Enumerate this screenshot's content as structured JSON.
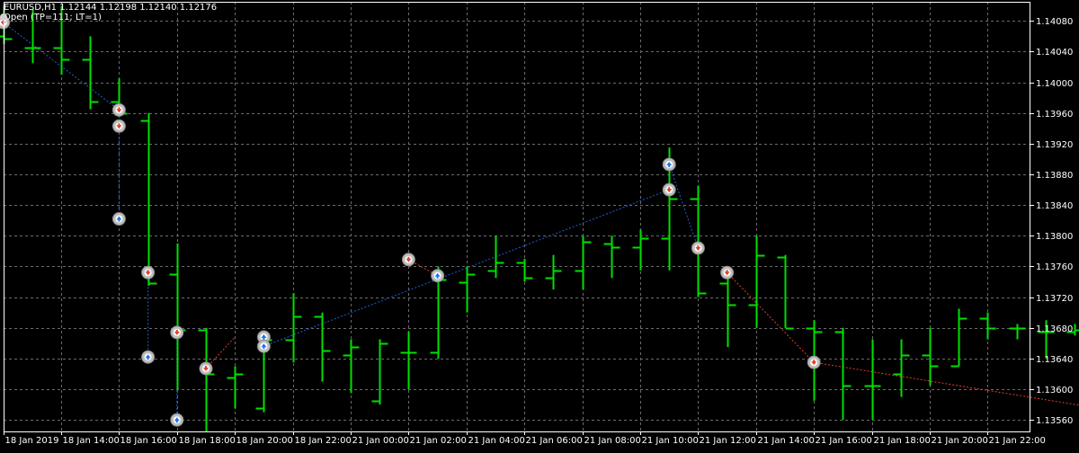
{
  "header": {
    "symbol_line": "EURUSD,H1  1.12144 1.12198 1.12140 1.12176",
    "indicator_line": "Open (TP=111; LT=1)"
  },
  "colors": {
    "background": "#000000",
    "grid": "#6b6b6b",
    "axis": "#ffffff",
    "bar": "#00e000",
    "buy_path": "#1f5fd0",
    "sell_path": "#e0402a",
    "marker_ring": "#bdbdbd",
    "buy_marker": "#1e73e8",
    "sell_marker": "#e0402a"
  },
  "chart_data": {
    "type": "ohlc",
    "symbol": "EURUSD",
    "timeframe": "H1",
    "ylim": [
      1.13545,
      1.14105
    ],
    "y_ticks": [
      "1.14080",
      "1.14040",
      "1.14000",
      "1.13960",
      "1.13920",
      "1.13880",
      "1.13840",
      "1.13800",
      "1.13760",
      "1.13720",
      "1.13680",
      "1.13640",
      "1.13600",
      "1.13560"
    ],
    "x_ticks": [
      "18 Jan 2019",
      "18 Jan 14:00",
      "18 Jan 16:00",
      "18 Jan 18:00",
      "18 Jan 20:00",
      "18 Jan 22:00",
      "21 Jan 00:00",
      "21 Jan 02:00",
      "21 Jan 04:00",
      "21 Jan 06:00",
      "21 Jan 08:00",
      "21 Jan 10:00",
      "21 Jan 12:00",
      "21 Jan 14:00",
      "21 Jan 16:00",
      "21 Jan 18:00",
      "21 Jan 20:00",
      "21 Jan 22:00"
    ],
    "bars": [
      {
        "time": "18 Jan 12:00",
        "open": 1.1406,
        "high": 1.141,
        "low": 1.1405,
        "close": 1.14057
      },
      {
        "time": "18 Jan 13:00",
        "open": 1.14045,
        "high": 1.14095,
        "low": 1.14025,
        "close": 1.14045
      },
      {
        "time": "18 Jan 14:00",
        "open": 1.14045,
        "high": 1.141,
        "low": 1.1401,
        "close": 1.1403
      },
      {
        "time": "18 Jan 15:00",
        "open": 1.1403,
        "high": 1.1406,
        "low": 1.13965,
        "close": 1.13975
      },
      {
        "time": "18 Jan 16:00",
        "open": 1.13975,
        "high": 1.14005,
        "low": 1.13955,
        "close": 1.1396
      },
      {
        "time": "18 Jan 17:00",
        "open": 1.1395,
        "high": 1.1396,
        "low": 1.13735,
        "close": 1.13738
      },
      {
        "time": "18 Jan 18:00",
        "open": 1.1375,
        "high": 1.1379,
        "low": 1.136,
        "close": 1.13677
      },
      {
        "time": "18 Jan 19:00",
        "open": 1.13677,
        "high": 1.1368,
        "low": 1.13545,
        "close": 1.1362
      },
      {
        "time": "18 Jan 20:00",
        "open": 1.13615,
        "high": 1.1363,
        "low": 1.13575,
        "close": 1.1362
      },
      {
        "time": "18 Jan 21:00",
        "open": 1.13575,
        "high": 1.1367,
        "low": 1.1357,
        "close": 1.13665
      },
      {
        "time": "18 Jan 22:00",
        "open": 1.13665,
        "high": 1.13725,
        "low": 1.13635,
        "close": 1.13695
      },
      {
        "time": "18 Jan 23:00",
        "open": 1.13695,
        "high": 1.137,
        "low": 1.1361,
        "close": 1.1365
      },
      {
        "time": "21 Jan 00:00",
        "open": 1.13645,
        "high": 1.13665,
        "low": 1.13595,
        "close": 1.13655
      },
      {
        "time": "21 Jan 01:00",
        "open": 1.13585,
        "high": 1.13665,
        "low": 1.1358,
        "close": 1.1366
      },
      {
        "time": "21 Jan 02:00",
        "open": 1.13648,
        "high": 1.13675,
        "low": 1.136,
        "close": 1.13648
      },
      {
        "time": "21 Jan 03:00",
        "open": 1.13648,
        "high": 1.1376,
        "low": 1.1364,
        "close": 1.13743
      },
      {
        "time": "21 Jan 04:00",
        "open": 1.1374,
        "high": 1.1376,
        "low": 1.137,
        "close": 1.1375
      },
      {
        "time": "21 Jan 05:00",
        "open": 1.13755,
        "high": 1.138,
        "low": 1.13745,
        "close": 1.13765
      },
      {
        "time": "21 Jan 06:00",
        "open": 1.13765,
        "high": 1.1377,
        "low": 1.1374,
        "close": 1.13745
      },
      {
        "time": "21 Jan 07:00",
        "open": 1.13745,
        "high": 1.13775,
        "low": 1.1373,
        "close": 1.13755
      },
      {
        "time": "21 Jan 08:00",
        "open": 1.13755,
        "high": 1.138,
        "low": 1.1373,
        "close": 1.13792
      },
      {
        "time": "21 Jan 09:00",
        "open": 1.1379,
        "high": 1.138,
        "low": 1.13745,
        "close": 1.13785
      },
      {
        "time": "21 Jan 10:00",
        "open": 1.13785,
        "high": 1.13808,
        "low": 1.13755,
        "close": 1.13797
      },
      {
        "time": "21 Jan 11:00",
        "open": 1.13797,
        "high": 1.13915,
        "low": 1.13755,
        "close": 1.13848
      },
      {
        "time": "21 Jan 12:00",
        "open": 1.13848,
        "high": 1.13865,
        "low": 1.1372,
        "close": 1.13725
      },
      {
        "time": "21 Jan 13:00",
        "open": 1.13738,
        "high": 1.1376,
        "low": 1.13655,
        "close": 1.1371
      },
      {
        "time": "21 Jan 14:00",
        "open": 1.1371,
        "high": 1.138,
        "low": 1.1368,
        "close": 1.13775
      },
      {
        "time": "21 Jan 15:00",
        "open": 1.13772,
        "high": 1.13775,
        "low": 1.1368,
        "close": 1.1368
      },
      {
        "time": "21 Jan 16:00",
        "open": 1.1368,
        "high": 1.1369,
        "low": 1.13585,
        "close": 1.13675
      },
      {
        "time": "21 Jan 17:00",
        "open": 1.13675,
        "high": 1.1368,
        "low": 1.1356,
        "close": 1.13605
      },
      {
        "time": "21 Jan 18:00",
        "open": 1.13605,
        "high": 1.13665,
        "low": 1.1356,
        "close": 1.13605
      },
      {
        "time": "21 Jan 19:00",
        "open": 1.1362,
        "high": 1.13665,
        "low": 1.1359,
        "close": 1.13645
      },
      {
        "time": "21 Jan 20:00",
        "open": 1.13645,
        "high": 1.1368,
        "low": 1.13605,
        "close": 1.1363
      },
      {
        "time": "21 Jan 21:00",
        "open": 1.1363,
        "high": 1.13705,
        "low": 1.1363,
        "close": 1.13693
      },
      {
        "time": "21 Jan 22:00",
        "open": 1.13693,
        "high": 1.137,
        "low": 1.13665,
        "close": 1.1368
      },
      {
        "time": "21 Jan 23:00",
        "open": 1.1368,
        "high": 1.13685,
        "low": 1.13665,
        "close": 1.1368
      },
      {
        "time": "22 Jan 00:00",
        "open": 1.13675,
        "high": 1.1369,
        "low": 1.1364,
        "close": 1.13675
      },
      {
        "time": "22 Jan 01:00",
        "open": 1.13675,
        "high": 1.13685,
        "low": 1.1367,
        "close": 1.13677
      },
      {
        "time": "22 Jan 02:00",
        "open": 1.13677,
        "high": 1.1369,
        "low": 1.13675,
        "close": 1.13685
      },
      {
        "time": "22 Jan 03:00",
        "open": 1.13685,
        "high": 1.1371,
        "low": 1.1366,
        "close": 1.1368
      },
      {
        "time": "22 Jan 04:00",
        "open": 1.1368,
        "high": 1.1369,
        "low": 1.13655,
        "close": 1.1366
      }
    ],
    "markers": [
      {
        "time": "18 Jan 12:00",
        "price": 1.14078,
        "side": "sell"
      },
      {
        "time": "18 Jan 16:00",
        "price": 1.13964,
        "side": "sell"
      },
      {
        "time": "18 Jan 16:00",
        "price": 1.13943,
        "side": "sell"
      },
      {
        "time": "18 Jan 16:00",
        "price": 1.13822,
        "side": "buy"
      },
      {
        "time": "18 Jan 17:00",
        "price": 1.13752,
        "side": "sell"
      },
      {
        "time": "18 Jan 17:00",
        "price": 1.13642,
        "side": "buy"
      },
      {
        "time": "18 Jan 18:00",
        "price": 1.13674,
        "side": "sell"
      },
      {
        "time": "18 Jan 18:00",
        "price": 1.1356,
        "side": "buy"
      },
      {
        "time": "18 Jan 19:00",
        "price": 1.13627,
        "side": "sell"
      },
      {
        "time": "18 Jan 21:00",
        "price": 1.13668,
        "side": "buy"
      },
      {
        "time": "18 Jan 21:00",
        "price": 1.13656,
        "side": "buy"
      },
      {
        "time": "21 Jan 02:00",
        "price": 1.13769,
        "side": "sell"
      },
      {
        "time": "21 Jan 03:00",
        "price": 1.13748,
        "side": "buy"
      },
      {
        "time": "21 Jan 11:00",
        "price": 1.13893,
        "side": "buy"
      },
      {
        "time": "21 Jan 11:00",
        "price": 1.1386,
        "side": "sell"
      },
      {
        "time": "21 Jan 12:00",
        "price": 1.13784,
        "side": "sell"
      },
      {
        "time": "21 Jan 13:00",
        "price": 1.13752,
        "side": "sell"
      },
      {
        "time": "21 Jan 16:00",
        "price": 1.13635,
        "side": "sell"
      }
    ],
    "trade_lines": [
      {
        "from_time": "18 Jan 12:00",
        "from_price": 1.14078,
        "to_time": "18 Jan 16:00",
        "to_price": 1.13964,
        "side": "buy"
      },
      {
        "from_time": "18 Jan 16:00",
        "from_price": 1.13943,
        "to_time": "18 Jan 16:00",
        "to_price": 1.13822,
        "side": "buy"
      },
      {
        "from_time": "18 Jan 17:00",
        "from_price": 1.13752,
        "to_time": "18 Jan 17:00",
        "to_price": 1.13642,
        "side": "buy"
      },
      {
        "from_time": "18 Jan 18:00",
        "from_price": 1.13674,
        "to_time": "18 Jan 18:00",
        "to_price": 1.1356,
        "side": "buy"
      },
      {
        "from_time": "18 Jan 19:00",
        "from_price": 1.13627,
        "to_time": "18 Jan 20:00",
        "to_price": 1.13668,
        "side": "sell"
      },
      {
        "from_time": "18 Jan 21:00",
        "from_price": 1.13656,
        "to_time": "21 Jan 11:00",
        "to_price": 1.1386,
        "side": "buy"
      },
      {
        "from_time": "21 Jan 02:00",
        "from_price": 1.13769,
        "to_time": "21 Jan 03:00",
        "to_price": 1.13748,
        "side": "sell"
      },
      {
        "from_time": "21 Jan 11:00",
        "from_price": 1.13893,
        "to_time": "21 Jan 12:00",
        "to_price": 1.13784,
        "side": "buy"
      },
      {
        "from_time": "21 Jan 13:00",
        "from_price": 1.13752,
        "to_time": "21 Jan 16:00",
        "to_price": 1.13635,
        "side": "sell"
      },
      {
        "from_time": "21 Jan 16:00",
        "from_price": 1.13635,
        "to_time": "22 Jan 04:00",
        "to_price": 1.13562,
        "side": "sell"
      }
    ],
    "grid": true
  }
}
